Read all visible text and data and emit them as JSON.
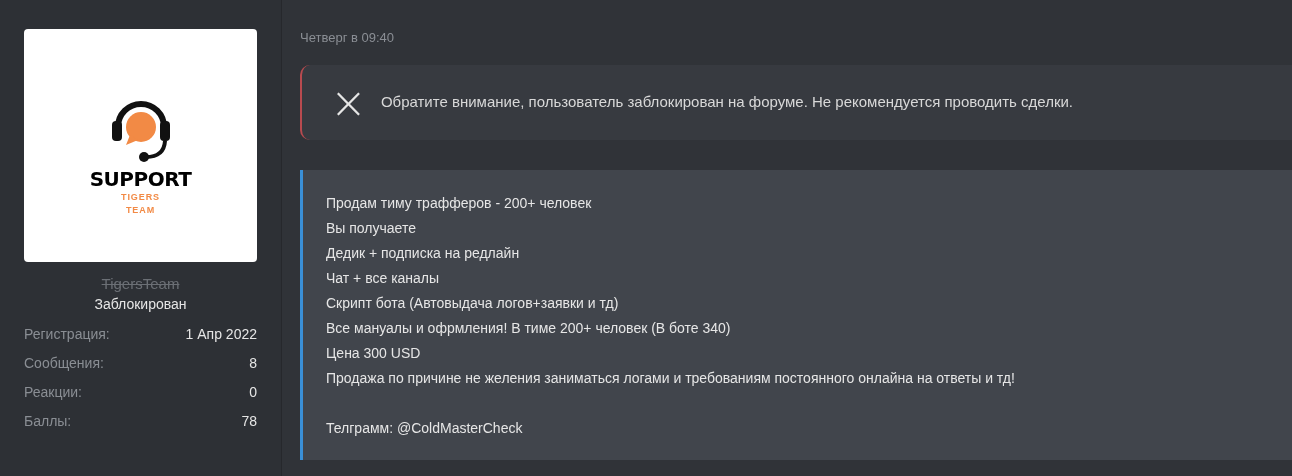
{
  "user": {
    "avatar": {
      "logo_title": "SUPPORT",
      "logo_lines": [
        "TIGERS",
        "TEAM"
      ]
    },
    "name": "TigersTeam",
    "banned": true,
    "status": "Заблокирован",
    "stats": [
      {
        "label": "Регистрация:",
        "value": "1 Апр 2022"
      },
      {
        "label": "Сообщения:",
        "value": "8"
      },
      {
        "label": "Реакции:",
        "value": "0"
      },
      {
        "label": "Баллы:",
        "value": "78"
      }
    ]
  },
  "post": {
    "date": "Четверг в 09:40",
    "warning": {
      "icon": "×",
      "text": "Обратите внимание, пользователь заблокирован на форуме. Не рекомендуется проводить сделки."
    },
    "body": [
      "Продам тиму трафферов - 200+ человек",
      "Вы получаете",
      "Дедик + подписка на редлайн",
      "Чат + все каналы",
      "Скрипт бота (Автовыдача логов+заявки и тд)",
      "Все мануалы и офрмления! В тиме 200+ человек (В боте 340)",
      "Цена 300 USD",
      "Продажа по причине не желения заниматься логами и требованиям постоянного онлайна на ответы и тд!"
    ],
    "contact": "Телграмм: @ColdMasterCheck"
  }
}
